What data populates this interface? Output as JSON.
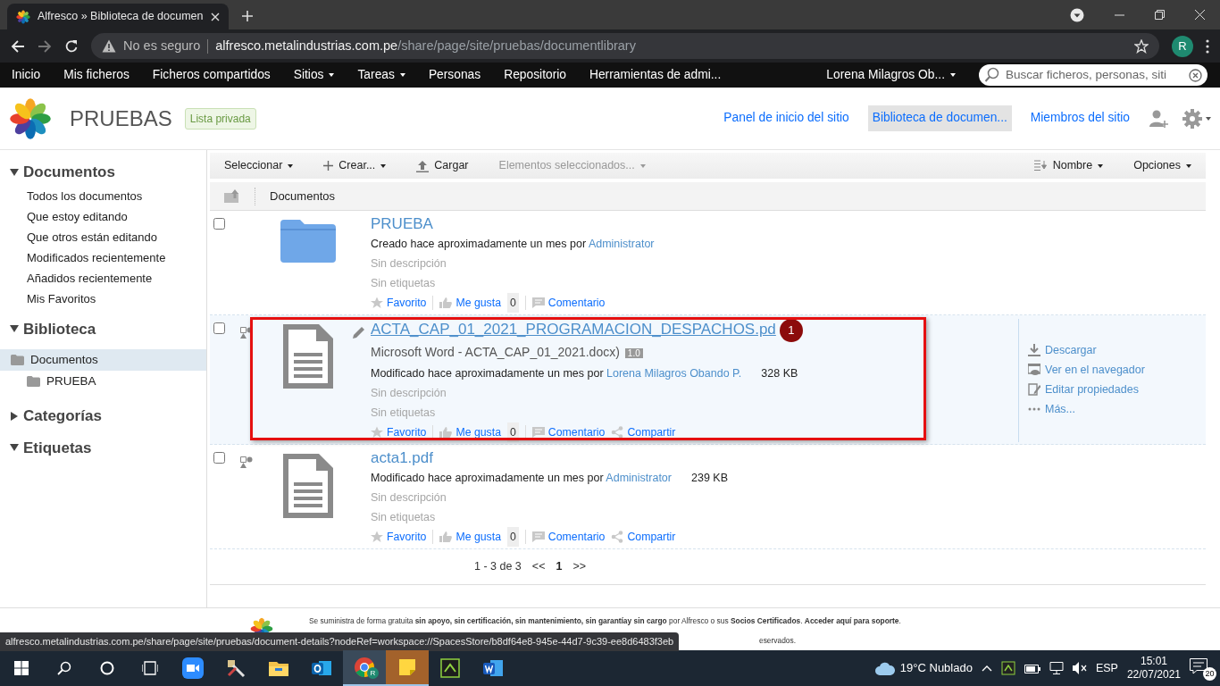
{
  "browser": {
    "tab_title": "Alfresco » Biblioteca de documen",
    "security": "No es seguro",
    "url_host": "alfresco.metalindustrias.com.pe",
    "url_path": "/share/page/site/pruebas/documentlibrary",
    "profile": "R"
  },
  "app_nav": {
    "items": [
      {
        "label": "Inicio",
        "dropdown": false
      },
      {
        "label": "Mis ficheros",
        "dropdown": false
      },
      {
        "label": "Ficheros compartidos",
        "dropdown": false
      },
      {
        "label": "Sitios",
        "dropdown": true
      },
      {
        "label": "Tareas",
        "dropdown": true
      },
      {
        "label": "Personas",
        "dropdown": false
      },
      {
        "label": "Repositorio",
        "dropdown": false
      },
      {
        "label": "Herramientas de admi...",
        "dropdown": false
      }
    ],
    "user": "Lorena Milagros Ob...",
    "search_placeholder": "Buscar ficheros, personas, siti"
  },
  "site": {
    "title": "PRUEBAS",
    "visibility": "Lista privada",
    "nav": [
      {
        "label": "Panel de inicio del sitio",
        "selected": false
      },
      {
        "label": "Biblioteca de documen...",
        "selected": true
      },
      {
        "label": "Miembros del sitio",
        "selected": false
      }
    ]
  },
  "sidebar": [
    {
      "title": "Documentos",
      "expanded": true,
      "items": [
        "Todos los documentos",
        "Que estoy editando",
        "Que otros están editando",
        "Modificados recientemente",
        "Añadidos recientemente",
        "Mis Favoritos"
      ]
    },
    {
      "title": "Biblioteca",
      "expanded": true,
      "tree": [
        {
          "label": "Documentos",
          "selected": true,
          "children": [
            {
              "label": "PRUEBA",
              "selected": false
            }
          ]
        }
      ]
    },
    {
      "title": "Categorías",
      "expanded": false
    },
    {
      "title": "Etiquetas",
      "expanded": true
    }
  ],
  "toolbar": [
    {
      "kind": "menu",
      "label": "Seleccionar",
      "disabled": false
    },
    {
      "kind": "create",
      "label": "Crear...",
      "disabled": false
    },
    {
      "kind": "upload",
      "label": "Cargar",
      "disabled": false
    },
    {
      "kind": "menu",
      "label": "Elementos seleccionados...",
      "disabled": true
    },
    {
      "kind": "sort",
      "label": "Nombre",
      "disabled": false
    },
    {
      "kind": "options",
      "label": "Opciones",
      "disabled": false
    }
  ],
  "breadcrumb": "Documentos",
  "documents": [
    {
      "kind": "folder",
      "checked": false,
      "highlighted": false,
      "editing": false,
      "name": "PRUEBA",
      "meta": "Creado hace aproximadamente un mes por",
      "author": "Administrator",
      "description": "Sin descripción",
      "tags": "Sin etiquetas",
      "actions": {
        "favorite": "Favorito",
        "like": "Me gusta",
        "likes": "0",
        "comment": "Comentario"
      }
    },
    {
      "kind": "document",
      "checked": false,
      "highlighted": true,
      "editing": true,
      "name": "ACTA_CAP_01_2021_PROGRAMACION_DESPACHOS.pd",
      "marker": "1",
      "title_rest": "Microsoft Word - ACTA_CAP_01_2021.docx)",
      "version": "1.0",
      "meta": "Modificado hace aproximadamente un mes por",
      "author": "Lorena Milagros Obando P.",
      "size": "328 KB",
      "description": "Sin descripción",
      "tags": "Sin etiquetas",
      "actions": {
        "favorite": "Favorito",
        "like": "Me gusta",
        "likes": "0",
        "comment": "Comentario",
        "share": "Compartir"
      },
      "row_actions": [
        {
          "kind": "download",
          "label": "Descargar"
        },
        {
          "kind": "view",
          "label": "Ver en el navegador"
        },
        {
          "kind": "edit",
          "label": "Editar propiedades"
        },
        {
          "kind": "more",
          "label": "Más..."
        }
      ]
    },
    {
      "kind": "document",
      "checked": false,
      "highlighted": false,
      "editing": false,
      "name": "acta1.pdf",
      "meta": "Modificado hace aproximadamente un mes por",
      "author": "Administrator",
      "size": "239 KB",
      "description": "Sin descripción",
      "tags": "Sin etiquetas",
      "actions": {
        "favorite": "Favorito",
        "like": "Me gusta",
        "likes": "0",
        "comment": "Comentario",
        "share": "Compartir"
      }
    }
  ],
  "pagination": {
    "range": "1 - 3 de 3",
    "prev": "<<",
    "current": "1",
    "next": ">>"
  },
  "footer": {
    "notice": "Se suministra de forma gratuita **sin apoyo, sin certificación, sin mantenimiento, sin garantíay sin cargo** por Alfresco o sus **Socios Certificados**. **Acceder aquí para soporte**.",
    "line2": "eservados."
  },
  "status_url": "alfresco.metalindustrias.com.pe/share/page/site/pruebas/document-details?nodeRef=workspace://SpacesStore/b8df64e8-945e-44d7-9c39-ee8d6483f3eb",
  "taskbar": {
    "apps": [
      {
        "kind": "zoom",
        "active": false
      },
      {
        "kind": "tools",
        "active": false
      },
      {
        "kind": "explorer",
        "active": false
      },
      {
        "kind": "outlook",
        "active": false
      },
      {
        "kind": "chrome",
        "active": true,
        "badge": "R"
      },
      {
        "kind": "sticky",
        "active": true
      },
      {
        "kind": "green",
        "active": false
      },
      {
        "kind": "word",
        "active": false
      }
    ],
    "weather": "19°C Nublado",
    "language": "ESP",
    "time": "15:01",
    "date": "22/07/2021",
    "notifications": "20"
  }
}
